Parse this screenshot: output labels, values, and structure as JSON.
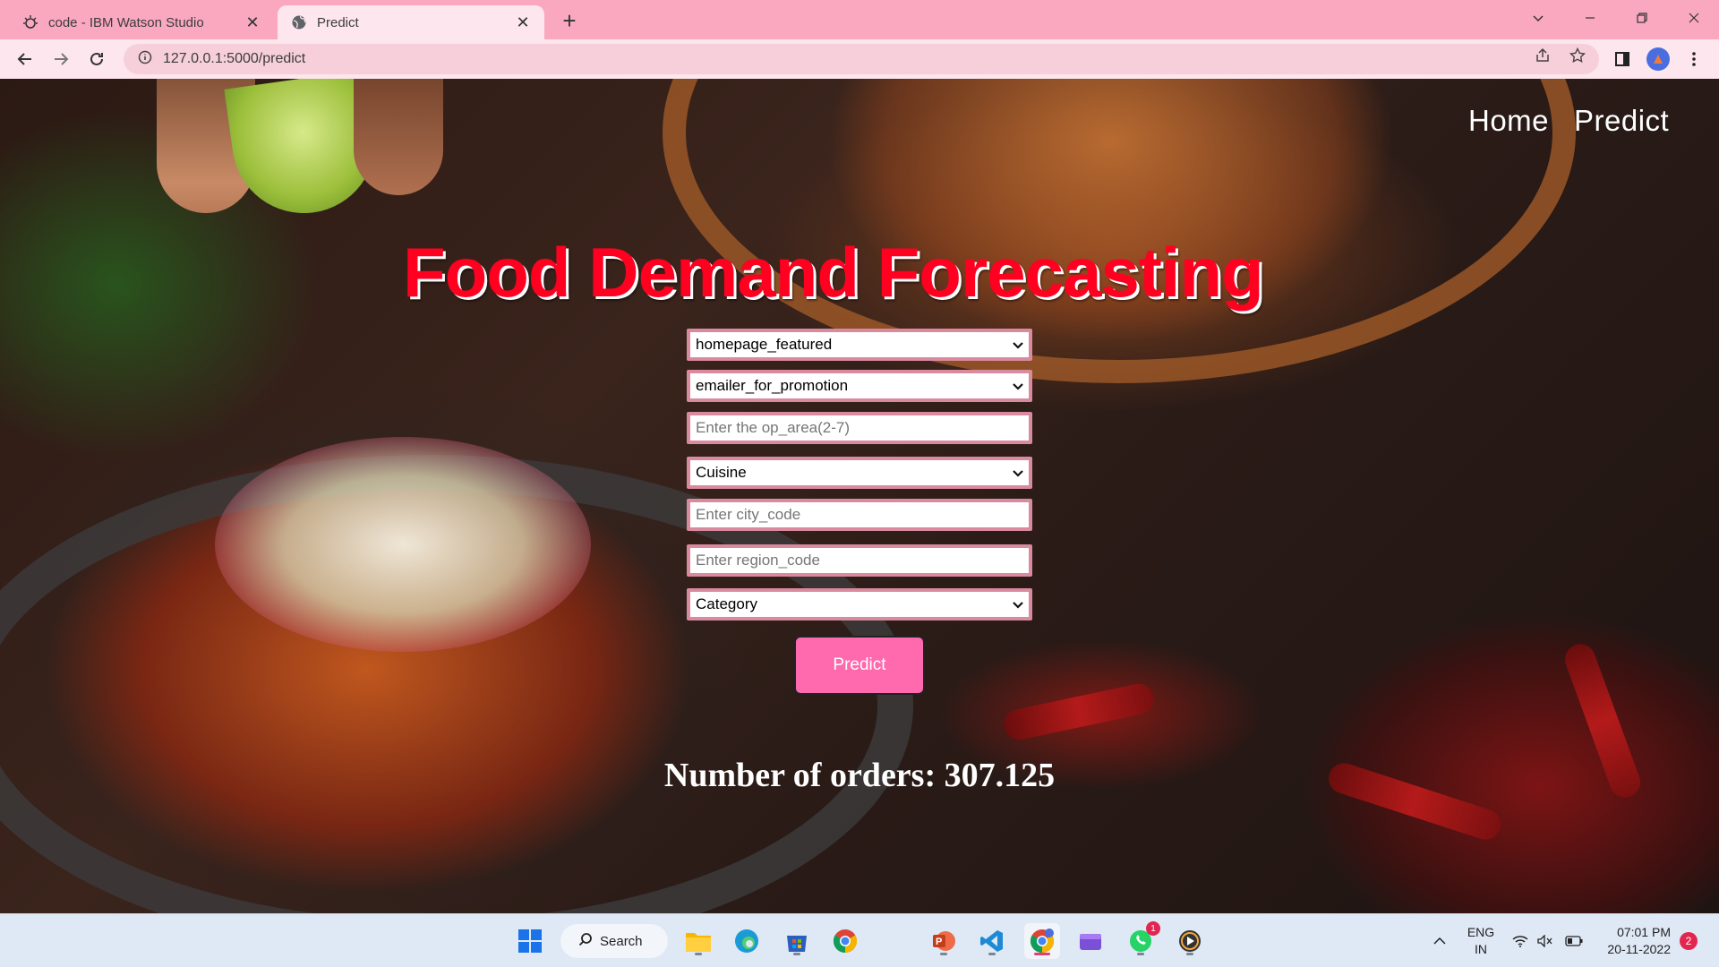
{
  "browser": {
    "tabs": [
      {
        "title": "code - IBM Watson Studio",
        "icon": "watson-studio-icon",
        "active": false
      },
      {
        "title": "Predict",
        "icon": "globe-icon",
        "active": true
      }
    ],
    "url": "127.0.0.1:5000/predict"
  },
  "nav": {
    "home": "Home",
    "predict": "Predict"
  },
  "page": {
    "title": "Food Demand Forecasting"
  },
  "form": {
    "homepage_featured": "homepage_featured",
    "emailer_for_promotion": "emailer_for_promotion",
    "op_area_placeholder": "Enter the op_area(2-7)",
    "cuisine": "Cuisine",
    "city_code_placeholder": "Enter city_code",
    "region_code_placeholder": "Enter region_code",
    "category": "Category",
    "submit": "Predict"
  },
  "result": {
    "text": "Number of orders: 307.125"
  },
  "taskbar": {
    "search": "Search",
    "lang_top": "ENG",
    "lang_bottom": "IN",
    "time": "07:01 PM",
    "date": "20-11-2022",
    "notification_count": "2",
    "whatsapp_badge": "1"
  },
  "colors": {
    "title_red": "#ff0020",
    "button_pink": "#ff69ad",
    "field_border": "#d98a9e",
    "tabstrip": "#f9a8c0"
  }
}
